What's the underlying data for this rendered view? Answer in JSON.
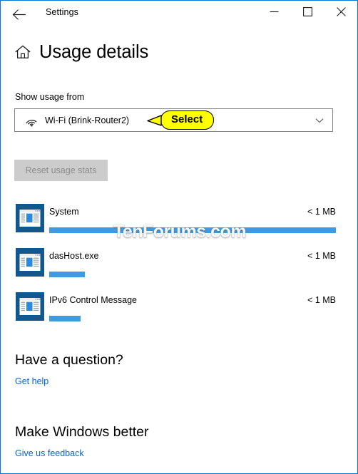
{
  "window": {
    "title": "Settings",
    "back_icon": "back-arrow-icon",
    "minimize_icon": "minimize-icon",
    "maximize_icon": "maximize-icon",
    "close_icon": "close-icon",
    "border_color": "#0078d7"
  },
  "page": {
    "home_icon": "home-icon",
    "title": "Usage details"
  },
  "network_selector": {
    "label": "Show usage from",
    "icon": "wifi-icon",
    "selected_value": "Wi-Fi (Brink-Router2)",
    "chevron_icon": "chevron-down-icon"
  },
  "callout": {
    "text": "Select",
    "fill_color": "#ffff00",
    "border_color": "#000000"
  },
  "reset_button": {
    "label": "Reset usage stats",
    "disabled": true
  },
  "usage": {
    "bar_color": "#3f9ae0",
    "rows": [
      {
        "icon": "app-window-icon",
        "name": "System",
        "size": "< 1 MB",
        "bar_percent": 100
      },
      {
        "icon": "app-window-icon",
        "name": "dasHost.exe",
        "size": "< 1 MB",
        "bar_percent": 12.5
      },
      {
        "icon": "app-window-icon",
        "name": "IPv6 Control Message",
        "size": "< 1 MB",
        "bar_percent": 11
      }
    ]
  },
  "watermark": {
    "text": "TenForums.com"
  },
  "help_section": {
    "heading": "Have a question?",
    "link": "Get help"
  },
  "feedback_section": {
    "heading": "Make Windows better",
    "link": "Give us feedback"
  }
}
